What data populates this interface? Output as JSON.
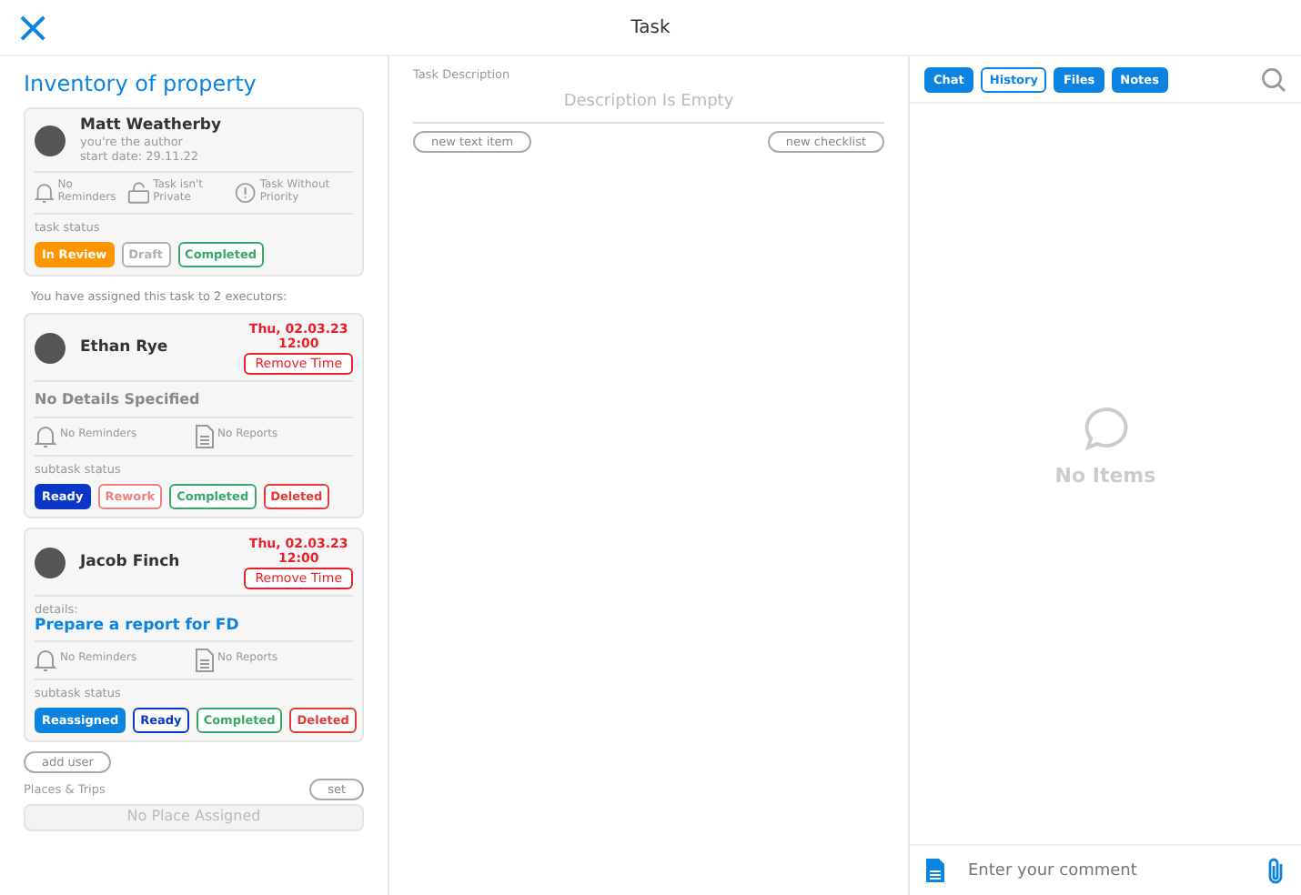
{
  "header": {
    "close_icon": "×",
    "title": "Task"
  },
  "task": {
    "title": "Inventory of property",
    "author": {
      "name": "Matt Weatherby",
      "role": "you're the author",
      "start_date": "start date: 29.11.22"
    },
    "flags": [
      {
        "kind": "bell",
        "label": "No Reminders"
      },
      {
        "kind": "lock",
        "label": "Task isn't Private"
      },
      {
        "kind": "alert",
        "label": "Task Without Priority"
      }
    ],
    "status_label": "task status",
    "statuses": [
      {
        "label": "In Review",
        "color": "#ff9500",
        "selected": true
      },
      {
        "label": "Draft",
        "color": "#b0b0b0",
        "selected": false
      },
      {
        "label": "Completed",
        "color": "#3aa86b",
        "selected": false
      }
    ]
  },
  "assigned_note": "You have assigned this task to 2 executors:",
  "executors": [
    {
      "name": "Ethan Rye",
      "date": "Thu, 02.03.23",
      "time": "12:00",
      "remove_button": "Remove Time",
      "details": "No Details Specified",
      "reminders": "No Reminders",
      "reports": "No Reports",
      "status_label": "subtask status",
      "statuses": [
        {
          "label": "Ready",
          "color": "#0a37c8",
          "selected": true
        },
        {
          "label": "Rework",
          "color": "#f08080",
          "selected": false
        },
        {
          "label": "Completed",
          "color": "#3aa86b",
          "selected": false
        },
        {
          "label": "Deleted",
          "color": "#e53935",
          "selected": false
        }
      ]
    },
    {
      "name": "Jacob Finch",
      "date": "Thu, 02.03.23",
      "time": "12:00",
      "remove_button": "Remove Time",
      "details_label": "details:",
      "details": "Prepare a report for FD",
      "reminders": "No Reminders",
      "reports": "No Reports",
      "status_label": "subtask status",
      "statuses": [
        {
          "label": "Reassigned",
          "color": "#0a84e0",
          "selected": true
        },
        {
          "label": "Ready",
          "color": "#0a37c8",
          "selected": false
        },
        {
          "label": "Completed",
          "color": "#3aa86b",
          "selected": false
        },
        {
          "label": "Deleted",
          "color": "#e53935",
          "selected": false
        }
      ]
    }
  ],
  "add_user": "add user",
  "places": {
    "label": "Places & Trips",
    "set_button": "set",
    "empty": "No Place Assigned"
  },
  "description": {
    "label": "Task Description",
    "empty": "Description Is Empty",
    "new_text_item": "new text item",
    "new_checklist": "new checklist"
  },
  "side_tabs": [
    {
      "label": "Chat",
      "selected": false
    },
    {
      "label": "History",
      "selected": true
    },
    {
      "label": "Files",
      "selected": false
    },
    {
      "label": "Notes",
      "selected": false
    }
  ],
  "empty_state": "No Items",
  "comment": {
    "placeholder": "Enter your comment"
  }
}
